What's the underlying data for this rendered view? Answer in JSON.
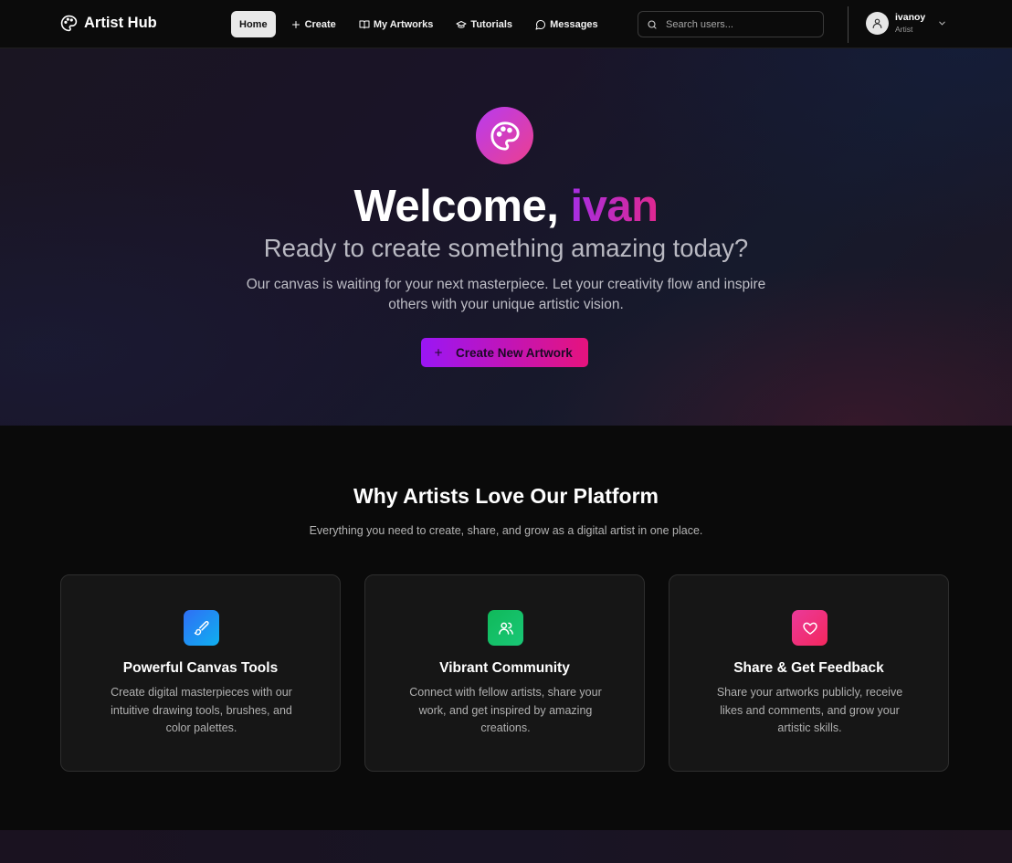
{
  "nav": {
    "brand": "Artist Hub",
    "links": [
      {
        "label": "Home",
        "icon": "none",
        "active": true
      },
      {
        "label": "Create",
        "icon": "plus-icon"
      },
      {
        "label": "My Artworks",
        "icon": "book-icon"
      },
      {
        "label": "Tutorials",
        "icon": "graduation-cap-icon"
      },
      {
        "label": "Messages",
        "icon": "message-circle-icon"
      }
    ],
    "search_placeholder": "Search users...",
    "user": {
      "name": "ivanoy",
      "role": "Artist"
    }
  },
  "hero": {
    "welcome_prefix": "Welcome, ",
    "username": "ivan",
    "subtitle": "Ready to create something amazing today?",
    "description": "Our canvas is waiting for your next masterpiece. Let your creativity flow and inspire others with your unique artistic vision.",
    "cta_label": "Create New Artwork"
  },
  "features": {
    "title": "Why Artists Love Our Platform",
    "subtitle": "Everything you need to create, share, and grow as a digital artist in one place.",
    "cards": [
      {
        "title": "Powerful Canvas Tools",
        "description": "Create digital masterpieces with our intuitive drawing tools, brushes, and color palettes.",
        "icon": "brush-icon",
        "color": "#1a8cf0"
      },
      {
        "title": "Vibrant Community",
        "description": "Connect with fellow artists, share your work, and get inspired by amazing creations.",
        "icon": "users-icon",
        "color": "#14c15e"
      },
      {
        "title": "Share & Get Feedback",
        "description": "Share your artworks publicly, receive likes and comments, and grow your artistic skills.",
        "icon": "heart-icon",
        "color": "#f2286f"
      }
    ]
  },
  "colors": {
    "accent_start": "#9a16f5",
    "accent_end": "#e6137d"
  }
}
